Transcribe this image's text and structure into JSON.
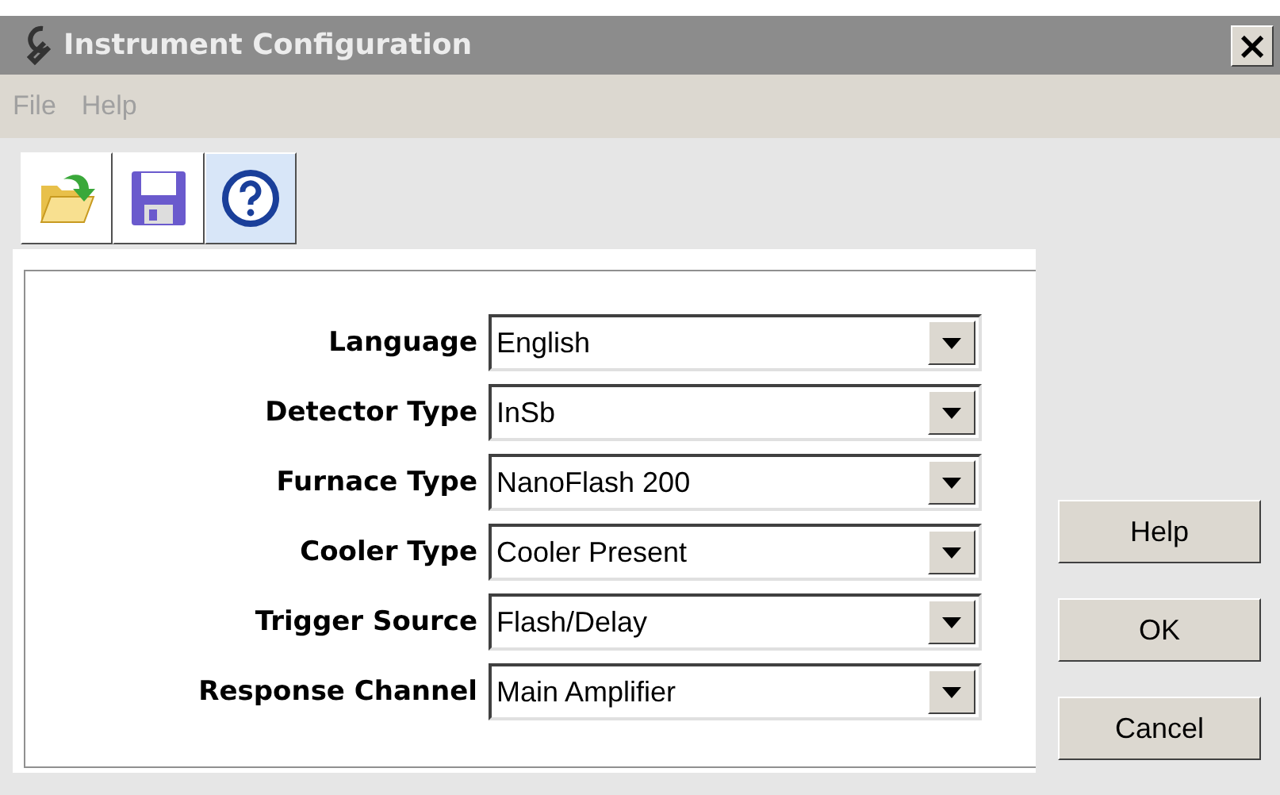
{
  "window": {
    "title": "Instrument Configuration",
    "close": "×"
  },
  "menu": [
    {
      "label": "File",
      "disabled": true
    },
    {
      "label": "Help",
      "disabled": true
    }
  ],
  "toolbar": [
    {
      "kind": "open",
      "pressed": false
    },
    {
      "kind": "save",
      "pressed": false
    },
    {
      "kind": "help",
      "pressed": true
    }
  ],
  "fields": [
    {
      "label": "Language",
      "value": "English"
    },
    {
      "label": "Detector Type",
      "value": "InSb"
    },
    {
      "label": "Furnace Type",
      "value": "NanoFlash 200"
    },
    {
      "label": "Cooler Type",
      "value": "Cooler Present"
    },
    {
      "label": "Trigger Source",
      "value": "Flash/Delay"
    },
    {
      "label": "Response Channel",
      "value": "Main Amplifier"
    }
  ],
  "buttons": [
    "Help",
    "OK",
    "Cancel"
  ]
}
